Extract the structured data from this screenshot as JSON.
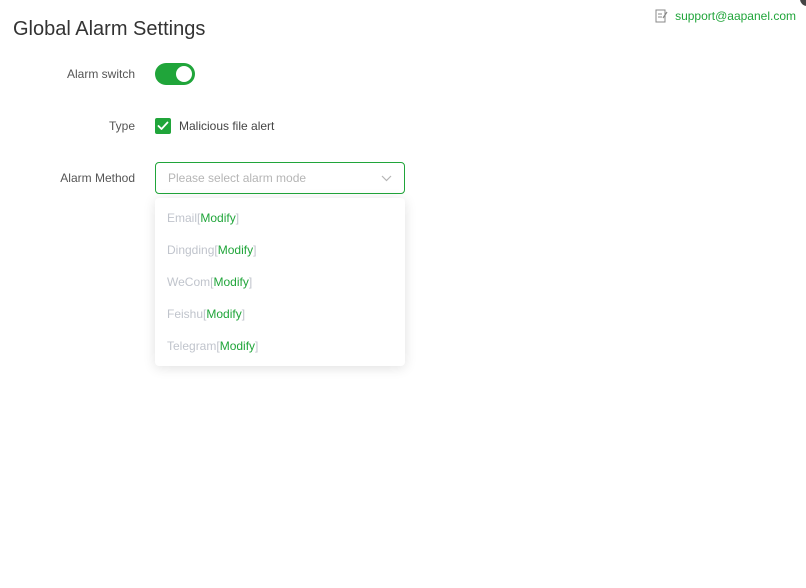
{
  "header": {
    "title": "Global Alarm Settings",
    "support_email": "support@aapanel.com"
  },
  "form": {
    "alarm_switch": {
      "label": "Alarm switch",
      "enabled": true
    },
    "type": {
      "label": "Type",
      "checkbox_label": "Malicious file alert",
      "checked": true
    },
    "alarm_method": {
      "label": "Alarm Method",
      "placeholder": "Please select alarm mode",
      "options": [
        {
          "name": "Email",
          "bracket_open": "[",
          "action": "Modify",
          "bracket_close": "]"
        },
        {
          "name": "Dingding",
          "bracket_open": "[",
          "action": "Modify",
          "bracket_close": "]"
        },
        {
          "name": "WeCom",
          "bracket_open": "[",
          "action": "Modify",
          "bracket_close": "]"
        },
        {
          "name": "Feishu",
          "bracket_open": "[",
          "action": "Modify",
          "bracket_close": "]"
        },
        {
          "name": "Telegram",
          "bracket_open": "[",
          "action": "Modify",
          "bracket_close": "]"
        }
      ]
    }
  },
  "icons": {
    "support": "edit-note-icon",
    "checkbox": "checkmark-icon",
    "select_arrow": "chevron-down-icon"
  },
  "colors": {
    "accent": "#20a53a",
    "disabled_text": "#c0c4cc"
  }
}
